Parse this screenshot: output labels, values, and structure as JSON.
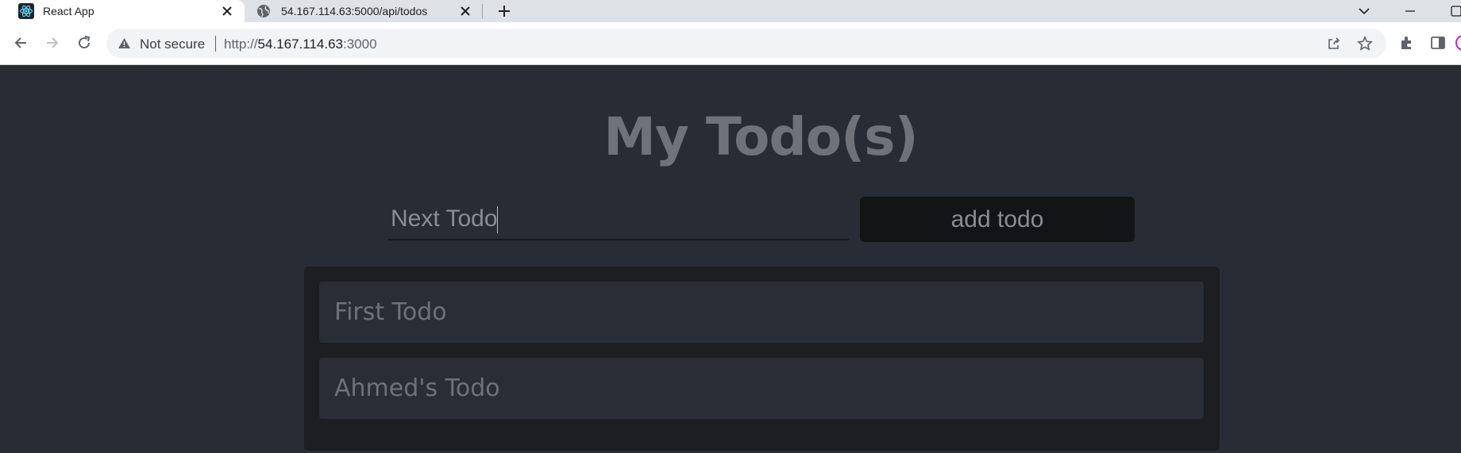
{
  "browser": {
    "tabs": [
      {
        "title": "React App",
        "icon": "react-logo-icon",
        "active": true
      },
      {
        "title": "54.167.114.63:5000/api/todos",
        "icon": "globe-icon",
        "active": false
      }
    ],
    "address_bar": {
      "security_label": "Not secure",
      "url_prefix": "http://",
      "url_host": "54.167.114.63",
      "url_port": ":3000"
    }
  },
  "app": {
    "title": "My Todo(s)",
    "input": {
      "value": "Next Todo",
      "placeholder": "Next Todo"
    },
    "add_button_label": "add todo",
    "todos": [
      "First Todo",
      "Ahmed's Todo"
    ]
  },
  "colors": {
    "background": "#282c34",
    "panel": "#1c1e22",
    "item": "#2a2d35",
    "button": "#131416",
    "text": "#6f7278"
  }
}
